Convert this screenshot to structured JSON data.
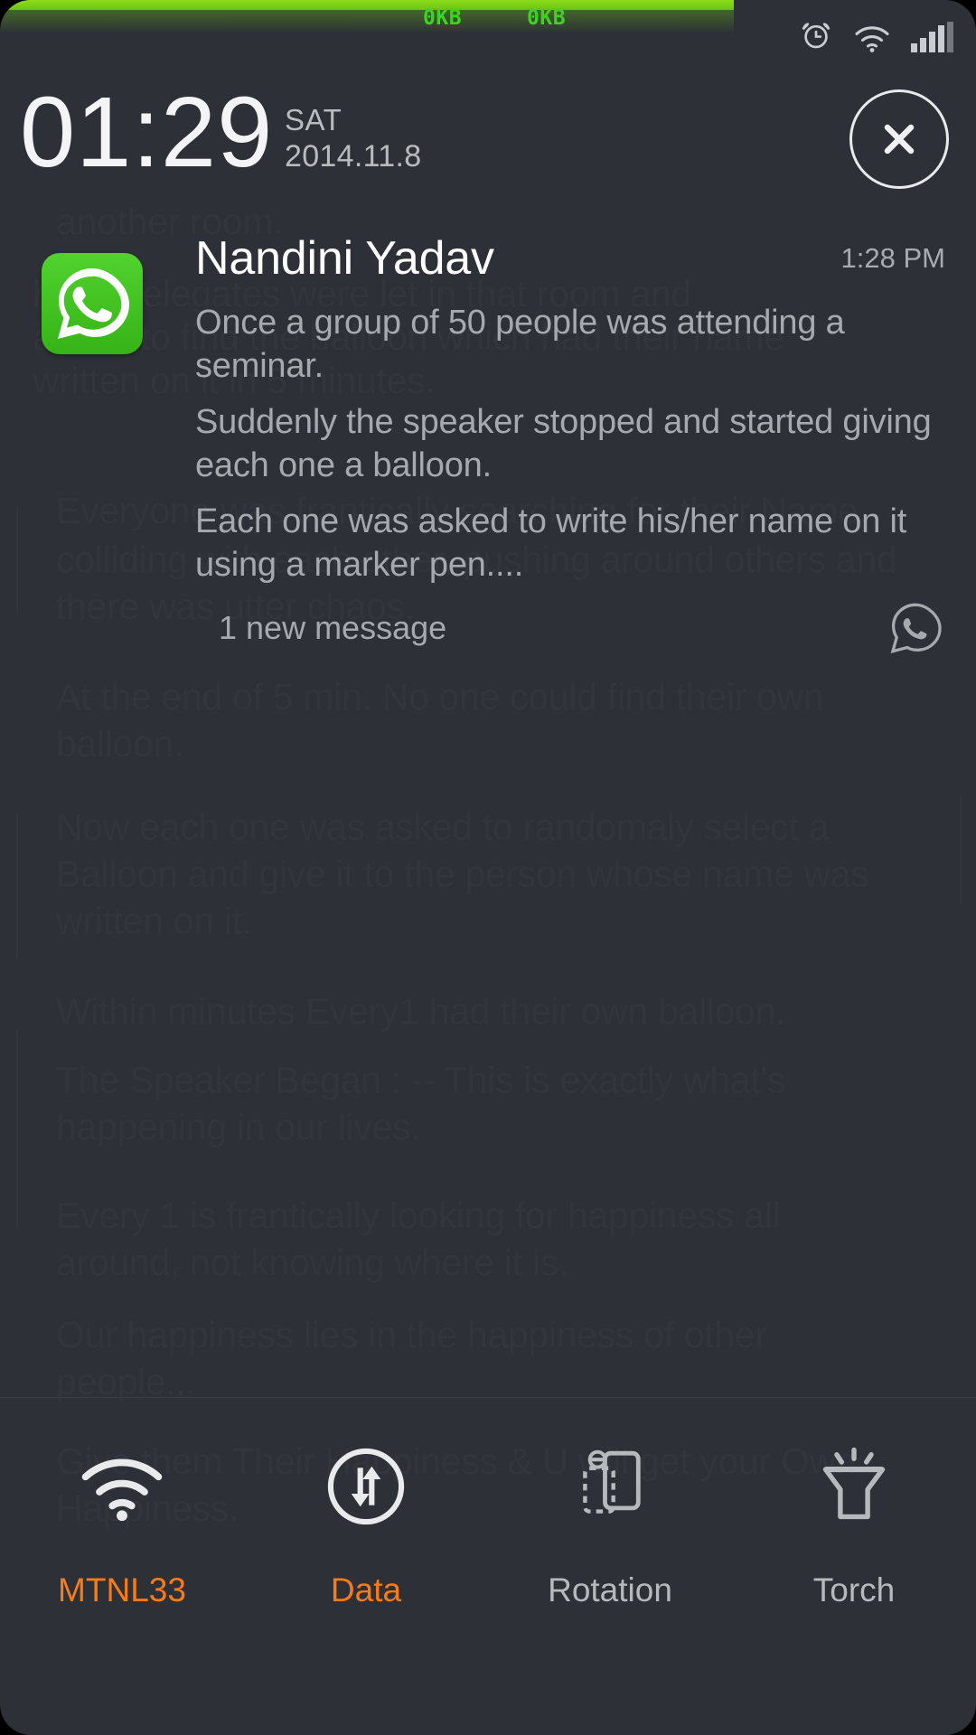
{
  "theme": {
    "shade_bg": "#2d3036",
    "accent_on": "#f57c18",
    "label_off": "#b7babd",
    "net_green": "#8ddc1c",
    "kb_green": "#3ed321",
    "whatsapp_green": "#51d22e"
  },
  "status_bar": {
    "download_rate": "0KB",
    "upload_rate": "0KB",
    "icons": [
      "alarm-icon",
      "wifi-icon",
      "signal-icon"
    ],
    "signal_bars_filled": 4,
    "signal_bars_total": 5
  },
  "header": {
    "time": "01:29",
    "day_of_week": "SAT",
    "date": "2014.11.8",
    "close_label": "Close"
  },
  "notification": {
    "app_icon": "whatsapp-icon",
    "title": "Nandini Yadav",
    "time": "1:28 PM",
    "paragraphs": [
      "Once a group of 50 people was attending a seminar.",
      "Suddenly the speaker stopped and started giving each one a balloon.",
      "Each one was asked to write his/her name on it using a marker pen...."
    ],
    "summary": "1 new message",
    "summary_icon": "whatsapp-glyph-icon"
  },
  "toggles": [
    {
      "label": "MTNL33",
      "icon": "wifi-icon",
      "state": "on"
    },
    {
      "label": "Data",
      "icon": "data-icon",
      "state": "on"
    },
    {
      "label": "Rotation",
      "icon": "rotation-icon",
      "state": "off"
    },
    {
      "label": "Torch",
      "icon": "torch-icon",
      "state": "off"
    }
  ],
  "wallpaper_text": [
    "another room.",
    "hese delegates were let in that room and",
    "asked to find the balloon which had their name",
    "written on it in 5 minutes.",
    "Everyone was frantically searching for their Name,",
    "colliding with each other, pushing around others and",
    "there was utter chaos.",
    "At the end of 5 min. No one could find their own",
    "balloon.",
    "Now each one was asked to randomaly select a",
    "Balloon and give it to the person whose name was",
    "written on it.",
    "Within minutes Every1 had their own balloon.",
    "The Speaker Began : -- This is exactly what's",
    "happening in our lives.",
    "Every 1 is frantically looking for happiness all",
    "around, not knowing where it is.",
    "Our happiness lies in the happiness of other",
    "people...",
    "Give them Their Happiness & U will get your Own",
    "Happiness."
  ]
}
